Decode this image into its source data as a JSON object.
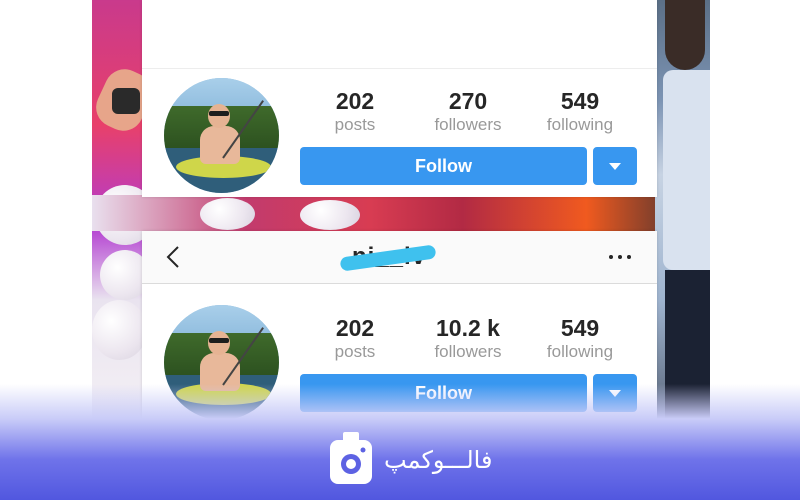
{
  "profiles": [
    {
      "username": "",
      "stats": [
        {
          "value": "202",
          "label": "posts"
        },
        {
          "value": "270",
          "label": "followers"
        },
        {
          "value": "549",
          "label": "following"
        }
      ],
      "follow_label": "Follow"
    },
    {
      "username": "ni__iv",
      "stats": [
        {
          "value": "202",
          "label": "posts"
        },
        {
          "value": "10.2 k",
          "label": "followers"
        },
        {
          "value": "549",
          "label": "following"
        }
      ],
      "follow_label": "Follow"
    }
  ],
  "icons": {
    "back": "chevron-left-icon",
    "more": "more-horizontal-icon",
    "dropdown": "triangle-down-icon",
    "brand": "camera-bag-icon"
  },
  "brand": {
    "name": "فالـــوکمپ"
  },
  "colors": {
    "follow_button": "#3897f0",
    "brand_band": "#5157df",
    "redaction": "#3fc1ee"
  }
}
